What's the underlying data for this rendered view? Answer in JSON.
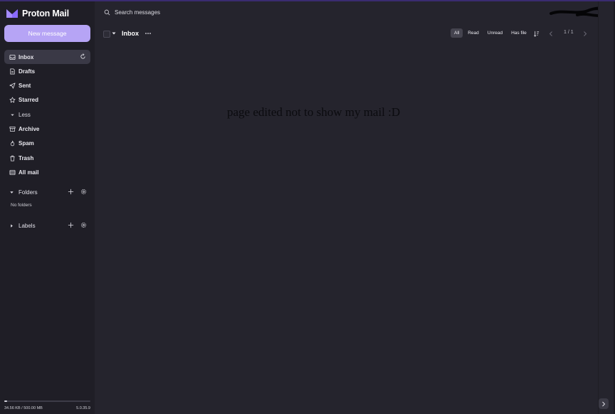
{
  "app": {
    "name": "Proton Mail",
    "brand_color": "#6d4aff",
    "accent_color": "#b6a4f5"
  },
  "sidebar": {
    "new_message_label": "New message",
    "items": [
      {
        "label": "Inbox",
        "icon": "inbox-icon",
        "active": true
      },
      {
        "label": "Drafts",
        "icon": "drafts-icon"
      },
      {
        "label": "Sent",
        "icon": "paper-plane-icon"
      },
      {
        "label": "Starred",
        "icon": "star-icon"
      },
      {
        "label": "Less",
        "icon": "chevron-down-icon"
      },
      {
        "label": "Archive",
        "icon": "archive-box-icon"
      },
      {
        "label": "Spam",
        "icon": "fire-icon"
      },
      {
        "label": "Trash",
        "icon": "trash-icon"
      },
      {
        "label": "All mail",
        "icon": "all-mail-icon"
      }
    ],
    "folders": {
      "label": "Folders",
      "empty_text": "No folders"
    },
    "labels": {
      "label": "Labels"
    },
    "storage": {
      "text": "34.56 KB / 500.00 MB",
      "fraction": 0.0001
    },
    "version": "5.0.35.9"
  },
  "header": {
    "search_placeholder": "Search messages"
  },
  "toolbar": {
    "title": "Inbox",
    "filters": [
      {
        "label": "All",
        "active": true
      },
      {
        "label": "Read"
      },
      {
        "label": "Unread"
      },
      {
        "label": "Has file"
      }
    ],
    "page_indicator": "1 / 1"
  },
  "main": {
    "note": "page edited not to show my mail :D"
  }
}
